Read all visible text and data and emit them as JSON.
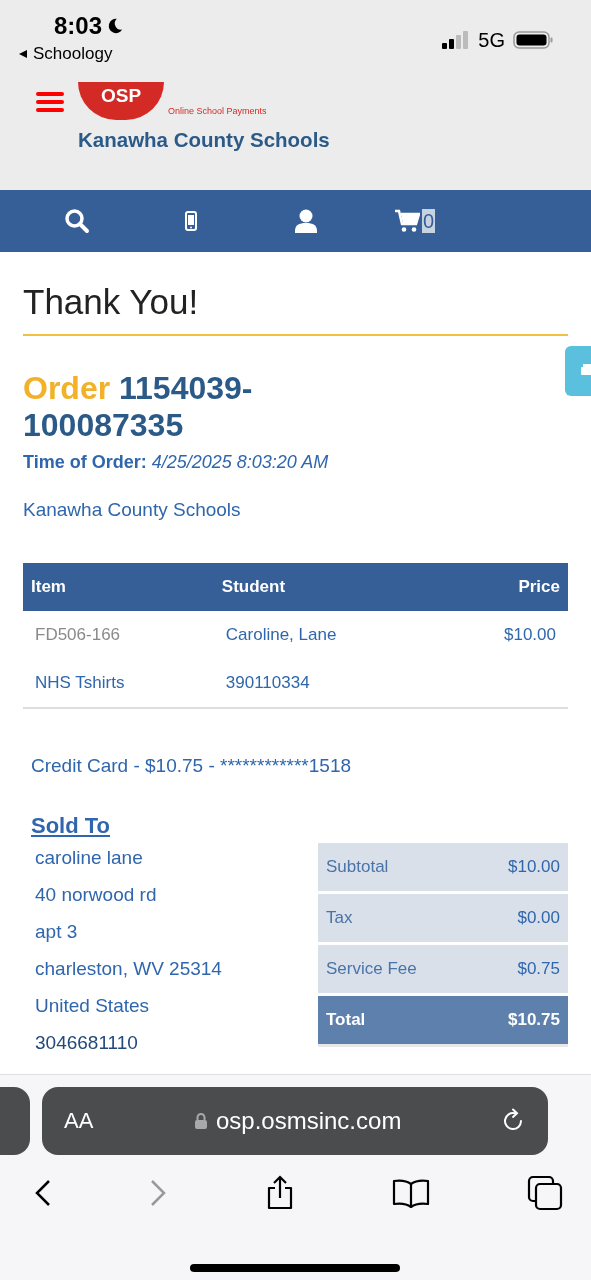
{
  "status_bar": {
    "time": "8:03",
    "back_label": "Schoology",
    "network": "5G"
  },
  "header": {
    "logo": "OSP",
    "tagline": "Online School Payments",
    "org": "Kanawha County Schools"
  },
  "nav": {
    "cart_count": "0"
  },
  "page": {
    "title": "Thank You!",
    "order_label": "Order",
    "order_number": "1154039-100087335",
    "time_label": "Time of Order:",
    "time_value": "4/25/2025 8:03:20 AM",
    "school": "Kanawha County Schools"
  },
  "table": {
    "columns": [
      "Item",
      "Student",
      "Price"
    ],
    "rows": [
      {
        "cells": [
          {
            "text": "FD506-166",
            "kind": "code"
          },
          {
            "text": "Caroline, Lane",
            "kind": "text"
          },
          {
            "text": "$10.00",
            "kind": "price"
          }
        ]
      },
      {
        "cells": [
          {
            "text": "NHS Tshirts",
            "kind": "text"
          },
          {
            "text": "390110334",
            "kind": "text"
          }
        ]
      }
    ]
  },
  "payment": "Credit Card - $10.75 - ************1518",
  "sold_to": {
    "heading": "Sold To",
    "lines": [
      "caroline lane",
      "40 norwood rd",
      "apt 3",
      "charleston, WV 25314",
      "United States",
      "3046681110"
    ]
  },
  "totals": [
    {
      "label": "Subtotal",
      "value": "$10.00",
      "kind": "line"
    },
    {
      "label": "Tax",
      "value": "$0.00",
      "kind": "line"
    },
    {
      "label": "Service Fee",
      "value": "$0.75",
      "kind": "line"
    },
    {
      "label": "Total",
      "value": "$10.75",
      "kind": "total"
    }
  ],
  "browser": {
    "text_size": "AA",
    "url": "osp.osmsinc.com",
    "forward_disabled": true
  }
}
